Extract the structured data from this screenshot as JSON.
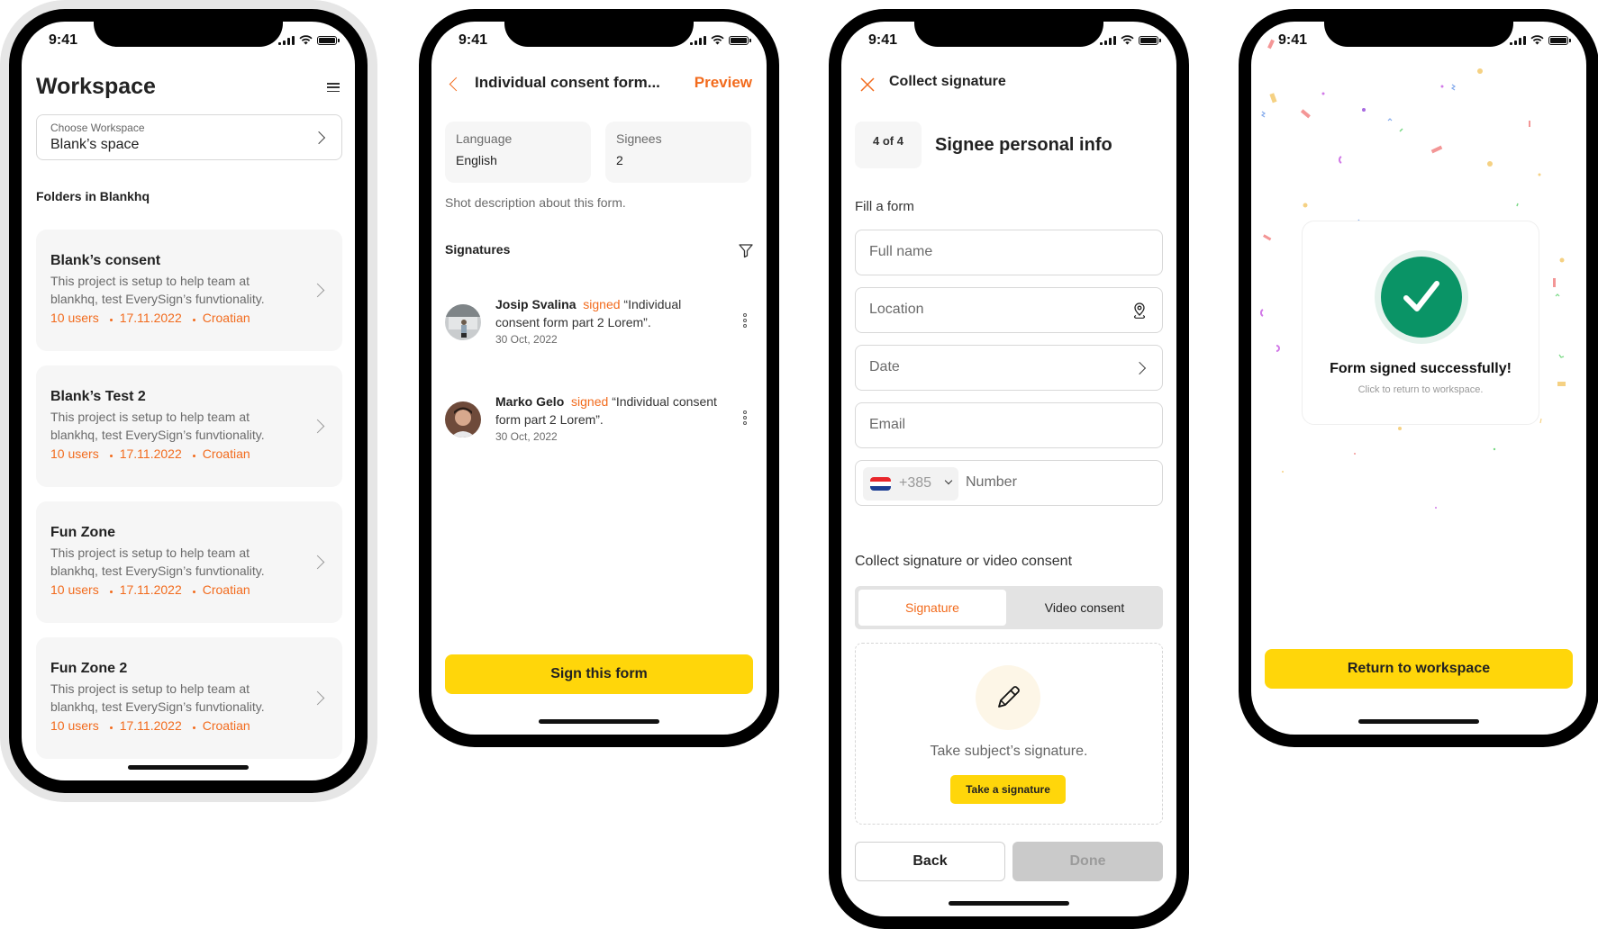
{
  "status_bar": {
    "time": "9:41"
  },
  "colors": {
    "accent": "#f26b1d",
    "primary_button": "#ffd60a",
    "success": "#0a9466",
    "card_bg": "#f6f6f6"
  },
  "workspace_screen": {
    "title": "Workspace",
    "menu_icon": "hamburger-icon",
    "selector": {
      "label": "Choose Workspace",
      "value": "Blank’s space"
    },
    "section_label": "Folders in Blankhq",
    "folders": [
      {
        "name": "Blank’s consent",
        "description": "This project is setup to help team at blankhq, test EverySign’s funvtionality.",
        "users": "10 users",
        "date": "17.11.2022",
        "language": "Croatian"
      },
      {
        "name": "Blank’s Test 2",
        "description": "This project is setup to help team at blankhq, test EverySign’s funvtionality.",
        "users": "10 users",
        "date": "17.11.2022",
        "language": "Croatian"
      },
      {
        "name": "Fun Zone",
        "description": "This project is setup to help team at blankhq, test EverySign’s funvtionality.",
        "users": "10 users",
        "date": "17.11.2022",
        "language": "Croatian"
      },
      {
        "name": "Fun Zone 2",
        "description": "This project is setup to help team at blankhq, test EverySign’s funvtionality.",
        "users": "10 users",
        "date": "17.11.2022",
        "language": "Croatian"
      }
    ]
  },
  "form_screen": {
    "title": "Individual consent form...",
    "preview_label": "Preview",
    "info": [
      {
        "label": "Language",
        "value": "English"
      },
      {
        "label": "Signees",
        "value": "2"
      }
    ],
    "description": "Shot description about this form.",
    "signatures_heading": "Signatures",
    "signatures": [
      {
        "name": "Josip Svalina",
        "action": "signed",
        "document": "“Individual consent form part 2 Lorem”.",
        "date": "30 Oct, 2022"
      },
      {
        "name": "Marko Gelo",
        "action": "signed",
        "document": "“Individual consent form part 2 Lorem”.",
        "date": "30 Oct, 2022"
      }
    ],
    "sign_button": "Sign this form"
  },
  "collect_screen": {
    "title": "Collect signature",
    "step": "4 of 4",
    "step_title": "Signee personal info",
    "fill_label": "Fill a form",
    "fields": {
      "full_name": "Full name",
      "location": "Location",
      "date": "Date",
      "email": "Email",
      "phone_prefix": "+385",
      "phone_number": "Number"
    },
    "consent_label": "Collect signature or video consent",
    "tabs": [
      {
        "label": "Signature",
        "active": true
      },
      {
        "label": "Video consent",
        "active": false
      }
    ],
    "signature_prompt": "Take subject’s signature.",
    "take_signature_button": "Take a signature",
    "back_button": "Back",
    "done_button": "Done"
  },
  "success_screen": {
    "title": "Form signed successfully!",
    "subtitle": "Click to return to workspace.",
    "return_button": "Return to workspace"
  }
}
